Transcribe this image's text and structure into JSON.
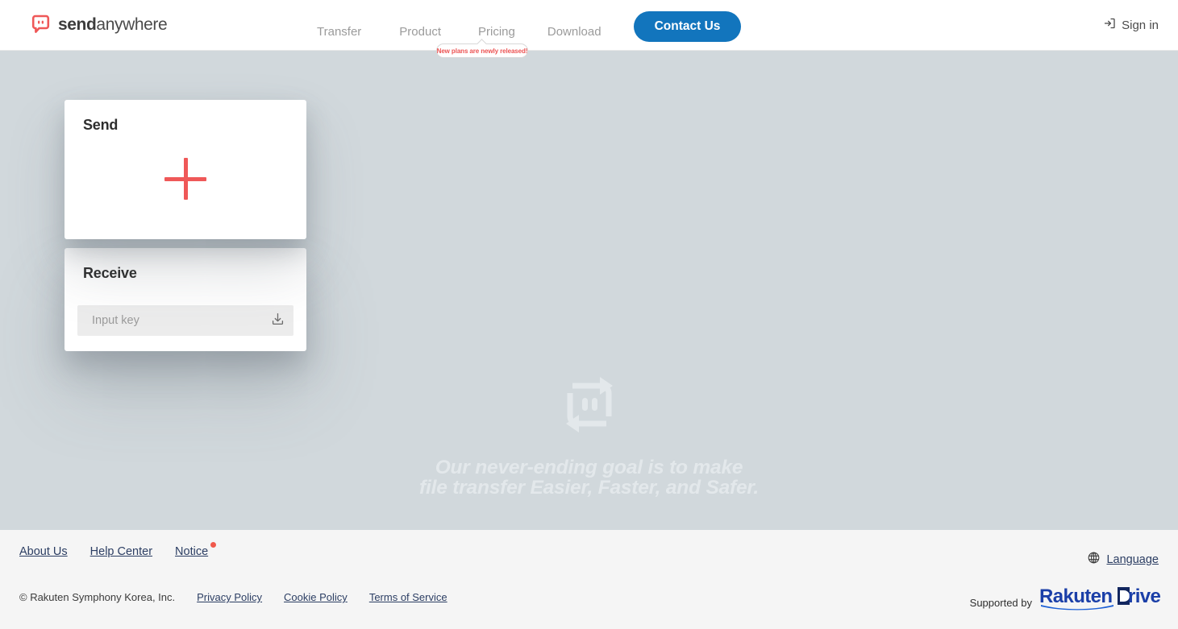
{
  "brand": {
    "logo_icon": "sendanywhere-logo-icon",
    "name_bold": "send",
    "name_light": "anywhere"
  },
  "header": {
    "nav": [
      {
        "label": "Transfer",
        "name": "nav-transfer"
      },
      {
        "label": "Product",
        "name": "nav-product"
      },
      {
        "label": "Pricing",
        "name": "nav-pricing"
      },
      {
        "label": "Download",
        "name": "nav-download"
      }
    ],
    "contact_button": "Contact Us",
    "tooltip": "New plans are newly released!",
    "signin_label": "Sign in",
    "signin_icon": "login-icon",
    "accent_blue": "#1275bd"
  },
  "main": {
    "send_card": {
      "title": "Send",
      "add_icon": "plus-icon",
      "accent_red": "#ef5858"
    },
    "receive_card": {
      "title": "Receive",
      "input_placeholder": "Input key",
      "input_value": "",
      "download_icon": "download-icon"
    },
    "watermark_icon": "sendanywhere-watermark-icon",
    "tagline_line1": "Our never-ending goal is to make",
    "tagline_line2": "file transfer Easier, Faster, and Safer.",
    "background_color": "#d1d8dc"
  },
  "footer": {
    "links": [
      {
        "label": "About Us",
        "name": "footer-link-about-us",
        "badge": false
      },
      {
        "label": "Help Center",
        "name": "footer-link-help-center",
        "badge": false
      },
      {
        "label": "Notice",
        "name": "footer-link-notice",
        "badge": true
      }
    ],
    "language_label": "Language",
    "language_icon": "globe-icon",
    "copyright": "© Rakuten Symphony Korea, Inc.",
    "legal_links": [
      {
        "label": "Privacy Policy",
        "name": "footer-link-privacy-policy"
      },
      {
        "label": "Cookie Policy",
        "name": "footer-link-cookie-policy"
      },
      {
        "label": "Terms of Service",
        "name": "footer-link-terms-of-service"
      }
    ],
    "supported_by": "Supported by",
    "partner_logo": "rakuten-drive-logo",
    "partner_name_1": "Rakuten",
    "partner_name_2": "Drive",
    "notice_badge_color": "#f0594c"
  }
}
